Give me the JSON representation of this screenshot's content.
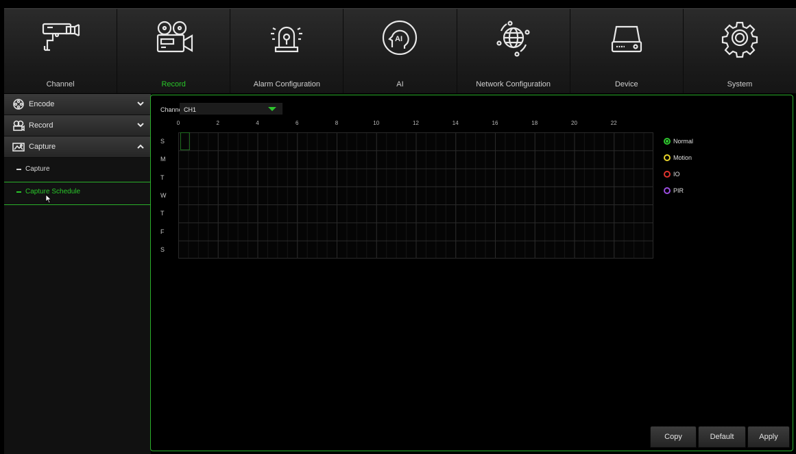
{
  "nav": {
    "tabs": [
      {
        "label": "Channel",
        "icon": "security-camera-icon",
        "active": false
      },
      {
        "label": "Record",
        "icon": "video-camera-icon",
        "active": true
      },
      {
        "label": "Alarm Configuration",
        "icon": "alarm-siren-icon",
        "active": false
      },
      {
        "label": "AI",
        "icon": "ai-head-icon",
        "active": false
      },
      {
        "label": "Network Configuration",
        "icon": "globe-network-icon",
        "active": false
      },
      {
        "label": "Device",
        "icon": "hard-drive-icon",
        "active": false
      },
      {
        "label": "System",
        "icon": "gear-icon",
        "active": false
      }
    ]
  },
  "sidebar": {
    "menus": [
      {
        "label": "Encode",
        "icon": "film-reel-icon",
        "expanded": false
      },
      {
        "label": "Record",
        "icon": "record-icon",
        "expanded": false
      },
      {
        "label": "Capture",
        "icon": "capture-icon",
        "expanded": true
      }
    ],
    "submenu": [
      {
        "label": "Capture",
        "active": false
      },
      {
        "label": "Capture Schedule",
        "active": true
      }
    ]
  },
  "schedule": {
    "channel_label": "Channel",
    "channel_value": "CH1",
    "hours": [
      "0",
      "2",
      "4",
      "6",
      "8",
      "10",
      "12",
      "14",
      "16",
      "18",
      "20",
      "22"
    ],
    "days": [
      "S",
      "M",
      "T",
      "W",
      "T",
      "F",
      "S"
    ],
    "legend": [
      {
        "label": "Normal",
        "color": "#2ec52e",
        "selected": true
      },
      {
        "label": "Motion",
        "color": "#e6d22a",
        "selected": false
      },
      {
        "label": "IO",
        "color": "#e0342e",
        "selected": false
      },
      {
        "label": "PIR",
        "color": "#9b4ee0",
        "selected": false
      }
    ]
  },
  "buttons": {
    "copy": "Copy",
    "default": "Default",
    "apply": "Apply"
  },
  "colors": {
    "accent": "#2ab02a",
    "active_text": "#29c729"
  }
}
